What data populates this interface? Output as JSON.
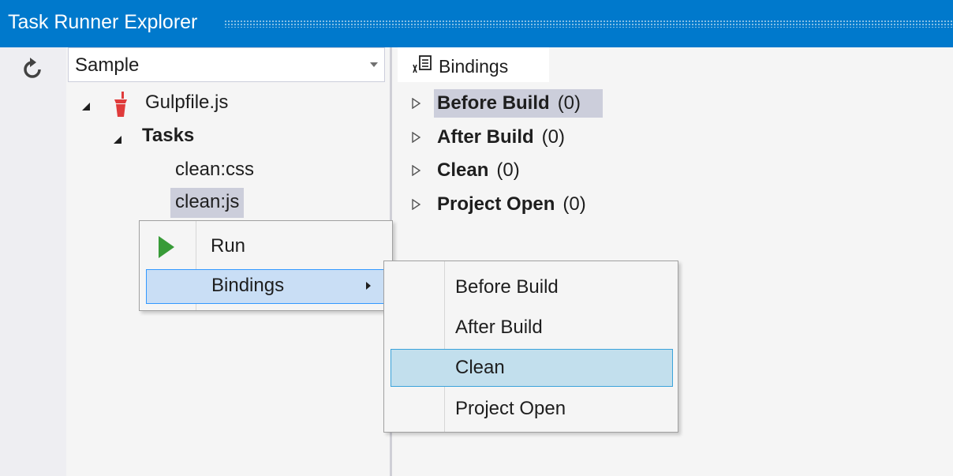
{
  "window": {
    "title": "Task Runner Explorer"
  },
  "toolbar": {
    "refresh_icon": "refresh-icon"
  },
  "project_selector": {
    "selected": "Sample"
  },
  "tree": {
    "file": {
      "label": "Gulpfile.js",
      "icon": "gulp-cup-icon",
      "icon_color": "#e03b3b"
    },
    "tasks_label": "Tasks",
    "tasks": [
      {
        "label": "clean:css"
      },
      {
        "label": "clean:js",
        "selected": true
      }
    ]
  },
  "right_pane": {
    "tab": {
      "label": "Bindings",
      "icon": "bindings-icon"
    },
    "bindings": [
      {
        "name": "Before Build",
        "count": "(0)",
        "selected": true
      },
      {
        "name": "After Build",
        "count": "(0)"
      },
      {
        "name": "Clean",
        "count": "(0)"
      },
      {
        "name": "Project Open",
        "count": "(0)"
      }
    ]
  },
  "context_menu": {
    "items": [
      {
        "label": "Run",
        "icon": "run-play-icon",
        "icon_color": "#389b38"
      },
      {
        "label": "Bindings",
        "has_submenu": true,
        "hovered": true
      }
    ],
    "submenu": {
      "items": [
        {
          "label": "Before Build"
        },
        {
          "label": "After Build"
        },
        {
          "label": "Clean",
          "hovered": true
        },
        {
          "label": "Project Open"
        }
      ]
    }
  }
}
